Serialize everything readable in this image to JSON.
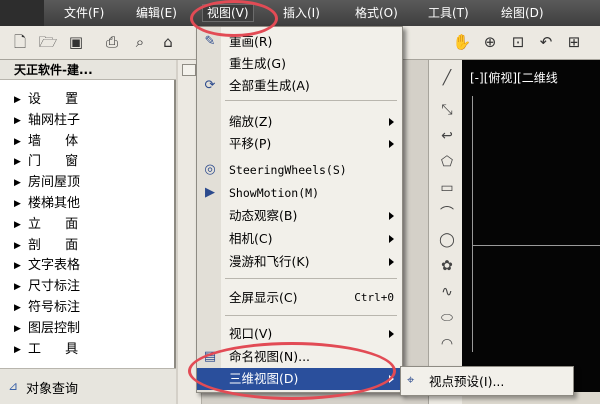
{
  "menubar": {
    "items": [
      {
        "label": "文件(F)",
        "active": false
      },
      {
        "label": "编辑(E)",
        "active": false
      },
      {
        "label": "视图(V)",
        "active": true
      },
      {
        "label": "插入(I)",
        "active": false
      },
      {
        "label": "格式(O)",
        "active": false
      },
      {
        "label": "工具(T)",
        "active": false
      },
      {
        "label": "绘图(D)",
        "active": false
      }
    ]
  },
  "toolbar": {
    "icons": [
      "new-file-icon",
      "open-folder-icon",
      "save-icon",
      "print-icon",
      "print-preview-icon",
      "publish-icon",
      "pan-hand-icon",
      "zoom-realtime-icon",
      "zoom-window-icon",
      "zoom-previous-icon"
    ]
  },
  "left_panel": {
    "title": "天正软件-建...",
    "items": [
      {
        "label": "设  置",
        "spaced": true
      },
      {
        "label": "轴网柱子",
        "spaced": false
      },
      {
        "label": "墙  体",
        "spaced": true
      },
      {
        "label": "门  窗",
        "spaced": true
      },
      {
        "label": "房间屋顶",
        "spaced": false
      },
      {
        "label": "楼梯其他",
        "spaced": false
      },
      {
        "label": "立  面",
        "spaced": true
      },
      {
        "label": "剖  面",
        "spaced": true
      },
      {
        "label": "文字表格",
        "spaced": false
      },
      {
        "label": "尺寸标注",
        "spaced": false
      },
      {
        "label": "符号标注",
        "spaced": false
      },
      {
        "label": "图层控制",
        "spaced": false
      },
      {
        "label": "工  具",
        "spaced": true
      }
    ],
    "bottom_item": "对象查询"
  },
  "view_menu": {
    "items": [
      {
        "label": "重画(R)",
        "icon": "redraw-icon",
        "arrow": false,
        "shortcut": "",
        "mono": false
      },
      {
        "label": "重生成(G)",
        "icon": "",
        "arrow": false,
        "shortcut": "",
        "mono": false
      },
      {
        "label": "全部重生成(A)",
        "icon": "regen-all-icon",
        "arrow": false,
        "shortcut": "",
        "mono": false
      },
      {
        "sep": true
      },
      {
        "label": "缩放(Z)",
        "icon": "",
        "arrow": true,
        "shortcut": "",
        "mono": false
      },
      {
        "label": "平移(P)",
        "icon": "",
        "arrow": true,
        "shortcut": "",
        "mono": false
      },
      {
        "label": "SteeringWheels(S)",
        "icon": "steering-wheel-icon",
        "arrow": false,
        "shortcut": "",
        "mono": true
      },
      {
        "label": "ShowMotion(M)",
        "icon": "showmotion-icon",
        "arrow": false,
        "shortcut": "",
        "mono": true
      },
      {
        "label": "动态观察(B)",
        "icon": "",
        "arrow": true,
        "shortcut": "",
        "mono": false
      },
      {
        "label": "相机(C)",
        "icon": "",
        "arrow": true,
        "shortcut": "",
        "mono": false
      },
      {
        "label": "漫游和飞行(K)",
        "icon": "",
        "arrow": true,
        "shortcut": "",
        "mono": false
      },
      {
        "sep": true
      },
      {
        "label": "全屏显示(C)",
        "icon": "",
        "arrow": false,
        "shortcut": "Ctrl+0",
        "mono": false
      },
      {
        "sep": true
      },
      {
        "label": "视口(V)",
        "icon": "",
        "arrow": true,
        "shortcut": "",
        "mono": false
      },
      {
        "label": "命名视图(N)...",
        "icon": "named-view-icon",
        "arrow": false,
        "shortcut": "",
        "mono": false
      },
      {
        "label": "三维视图(D)",
        "icon": "",
        "arrow": true,
        "shortcut": "",
        "mono": false,
        "selected": true
      }
    ]
  },
  "submenu": {
    "label": "视点预设(I)...",
    "icon": "viewpoint-preset-icon"
  },
  "drawing": {
    "label": "[-][俯视][二维线"
  },
  "colors": {
    "menubar": "#4a4a4a",
    "selection": "#2a4f9c",
    "annotation": "#e24b55",
    "canvas": "#050505"
  }
}
